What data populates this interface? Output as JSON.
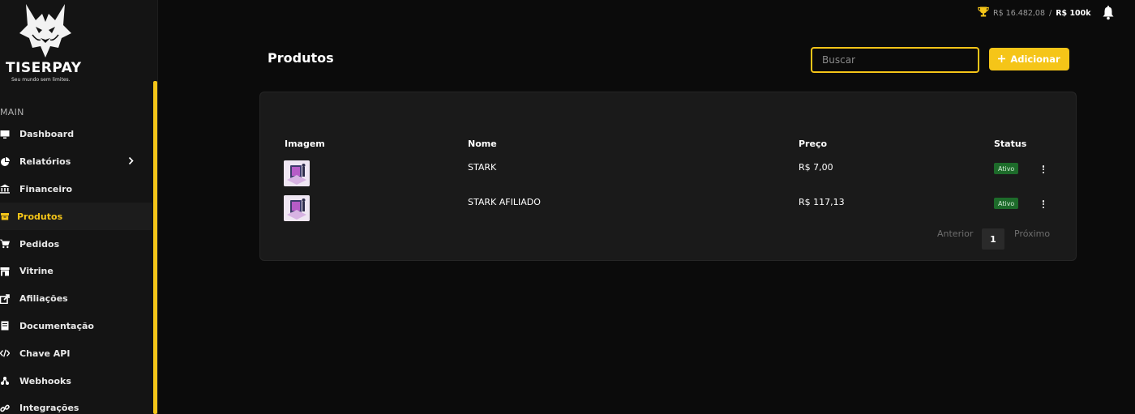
{
  "brand": {
    "name": "TISERPAY",
    "tagline": "Seu mundo sem limites."
  },
  "sidebar": {
    "section": "MAIN",
    "items": [
      {
        "label": "Dashboard",
        "icon": "monitor-icon"
      },
      {
        "label": "Relatórios",
        "icon": "pie-chart-icon"
      },
      {
        "label": "Financeiro",
        "icon": "bank-icon"
      },
      {
        "label": "Produtos",
        "icon": "box-icon",
        "active": true
      },
      {
        "label": "Pedidos",
        "icon": "cart-icon"
      },
      {
        "label": "Vitrine",
        "icon": "store-icon"
      },
      {
        "label": "Afiliações",
        "icon": "share-icon"
      },
      {
        "label": "Documentação",
        "icon": "document-icon"
      },
      {
        "label": "Chave API",
        "icon": "code-icon"
      },
      {
        "label": "Webhooks",
        "icon": "webhook-icon"
      },
      {
        "label": "Integrações",
        "icon": "link-icon"
      }
    ]
  },
  "topbar": {
    "balance_current": "R$ 16.482,08",
    "separator": "/",
    "balance_goal": "R$ 100k"
  },
  "page": {
    "title": "Produtos",
    "search_placeholder": "Buscar",
    "add_label": "Adicionar"
  },
  "table": {
    "headers": {
      "image": "Imagem",
      "name": "Nome",
      "price": "Preço",
      "status": "Status"
    },
    "rows": [
      {
        "name": "STARK",
        "price": "R$ 7,00",
        "status": "Ativo"
      },
      {
        "name": "STARK AFILIADO",
        "price": "R$ 117,13",
        "status": "Ativo"
      }
    ]
  },
  "pagination": {
    "prev": "Anterior",
    "current": "1",
    "next": "Próximo"
  },
  "colors": {
    "accent": "#f5c518",
    "background": "#0b0b0b",
    "card": "#1a1a1a",
    "status_active": "#1d6b2a"
  }
}
